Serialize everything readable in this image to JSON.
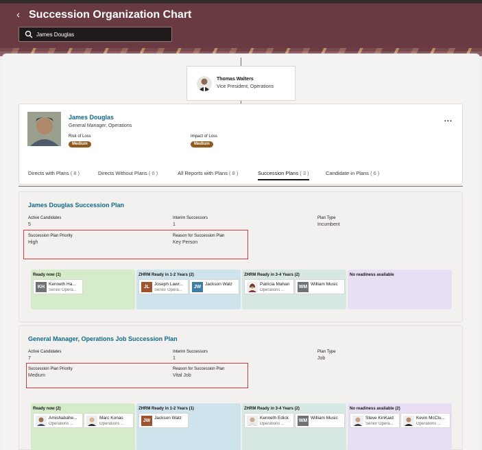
{
  "header": {
    "title": "Succession Organization Chart",
    "search_value": "James Douglas"
  },
  "manager": {
    "name": "Thomas Walters",
    "title": "Vice President, Operations"
  },
  "person": {
    "name": "James Douglas",
    "job": "General Manager, Operations",
    "risk_label": "Risk of Loss",
    "risk_value": "Medium",
    "impact_label": "Impact of Loss",
    "impact_value": "Medium",
    "more": "..."
  },
  "tabs": [
    {
      "label": "Directs with Plans",
      "count": "( 8 )"
    },
    {
      "label": "Directs Without Plans",
      "count": "( 0 )"
    },
    {
      "label": "All Reports with Plans",
      "count": "( 8 )"
    },
    {
      "label": "Succession Plans",
      "count": "( 3 )"
    },
    {
      "label": "Candidate in Plans",
      "count": "( 6 )"
    }
  ],
  "plans": [
    {
      "title": "James Douglas Succession Plan",
      "active_label": "Active Candidates",
      "active_value": "5",
      "interim_label": "Interim Successors",
      "interim_value": "1",
      "type_label": "Plan Type",
      "type_value": "Incumbent",
      "priority_label": "Succession Plan Priority",
      "priority_value": "High",
      "reason_label": "Reason for Succession Plan",
      "reason_value": "Key Person",
      "columns": [
        {
          "heading": "Ready now (1)",
          "cards": [
            {
              "initials": "KH",
              "name": "Kenneth Ha...",
              "role": "Senior Opera..."
            }
          ]
        },
        {
          "heading": "ZHRM Ready in 1-2 Years (2)",
          "cards": [
            {
              "initials": "JL",
              "name": "Joseph Lawr...",
              "role": "Senior Opera..."
            },
            {
              "initials": "JW",
              "name": "Jackson Walz",
              "role": ""
            }
          ]
        },
        {
          "heading": "ZHRM Ready in 3-4 Years (2)",
          "cards": [
            {
              "initials": "",
              "name": "Patricia Mahan",
              "role": "Operations ..."
            },
            {
              "initials": "WM",
              "name": "William Music",
              "role": ""
            }
          ]
        },
        {
          "heading": "No readiness available",
          "cards": []
        }
      ]
    },
    {
      "title": "General Manager, Operations Job Succession Plan",
      "active_label": "Active Candidates",
      "active_value": "7",
      "interim_label": "Interim Successors",
      "interim_value": "1",
      "type_label": "Plan Type",
      "type_value": "Job",
      "priority_label": "Succession Plan Priority",
      "priority_value": "Medium",
      "reason_label": "Reason for Succession Plan",
      "reason_value": "Vital Job",
      "columns": [
        {
          "heading": "Ready now (2)",
          "cards": [
            {
              "initials": "",
              "name": "Amishabahe...",
              "role": "Operations ..."
            },
            {
              "initials": "",
              "name": "Marc Konas",
              "role": "Operations ..."
            }
          ]
        },
        {
          "heading": "ZHRM Ready in 1-2 Years (1)",
          "cards": [
            {
              "initials": "JW",
              "name": "Jackson Walz",
              "role": ""
            }
          ]
        },
        {
          "heading": "ZHRM Ready in 3-4 Years (2)",
          "cards": [
            {
              "initials": "",
              "name": "Kenneth Edick",
              "role": "Operations ..."
            },
            {
              "initials": "WM",
              "name": "William Music",
              "role": ""
            }
          ]
        },
        {
          "heading": "No readiness available (2)",
          "cards": [
            {
              "initials": "",
              "name": "Steve KinKaid",
              "role": "Senior Opera..."
            },
            {
              "initials": "",
              "name": "Kevin McClu...",
              "role": "Operations ..."
            }
          ]
        }
      ]
    }
  ]
}
